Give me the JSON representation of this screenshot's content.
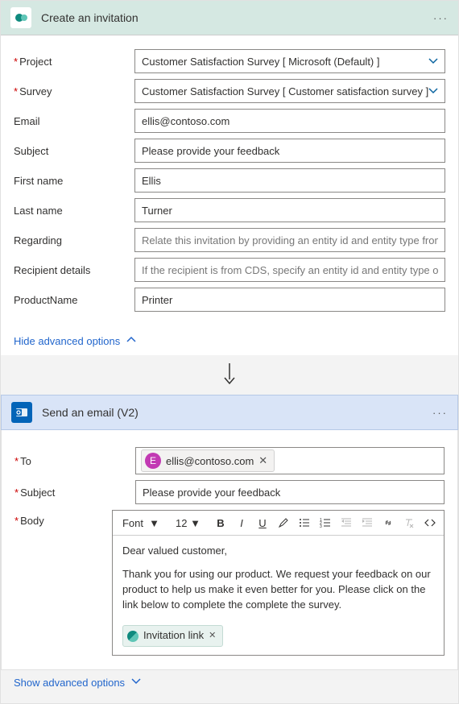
{
  "invitation": {
    "header": {
      "title": "Create an invitation",
      "menu_label": "···"
    },
    "fields": {
      "project": {
        "label": "Project",
        "value": "Customer Satisfaction Survey [ Microsoft (Default) ]",
        "required": true,
        "type": "select"
      },
      "survey": {
        "label": "Survey",
        "value": "Customer Satisfaction Survey [ Customer satisfaction survey ]",
        "required": true,
        "type": "select"
      },
      "email": {
        "label": "Email",
        "value": "ellis@contoso.com",
        "required": false,
        "type": "text"
      },
      "subject": {
        "label": "Subject",
        "value": "Please provide your feedback",
        "required": false,
        "type": "text"
      },
      "first_name": {
        "label": "First name",
        "value": "Ellis",
        "required": false,
        "type": "text"
      },
      "last_name": {
        "label": "Last name",
        "value": "Turner",
        "required": false,
        "type": "text"
      },
      "regarding": {
        "label": "Regarding",
        "placeholder": "Relate this invitation by providing an entity id and entity type from this CDS in t",
        "required": false,
        "type": "text"
      },
      "recipient": {
        "label": "Recipient details",
        "placeholder": "If the recipient is from CDS, specify an entity id and entity type of the recipient t",
        "required": false,
        "type": "text"
      },
      "product": {
        "label": "ProductName",
        "value": "Printer",
        "required": false,
        "type": "text"
      }
    },
    "adv_toggle": "Hide advanced options"
  },
  "email": {
    "header": {
      "title": "Send an email (V2)",
      "menu_label": "···"
    },
    "fields": {
      "to": {
        "label": "To",
        "required": true,
        "chip": {
          "initial": "E",
          "text": "ellis@contoso.com"
        }
      },
      "subject": {
        "label": "Subject",
        "required": true,
        "value": "Please provide your feedback"
      },
      "body": {
        "label": "Body",
        "required": true
      }
    },
    "rte": {
      "font_label": "Font",
      "size_label": "12",
      "buttons": {
        "bold": "B",
        "italic": "I",
        "underline": "U"
      },
      "text": {
        "greeting": "Dear valued customer,",
        "para": "Thank you for using our product. We request your feedback on our product to help us make it even better for you. Please click on the link below to complete the complete the survey."
      },
      "token": "Invitation link"
    },
    "adv_toggle": "Show advanced options"
  }
}
